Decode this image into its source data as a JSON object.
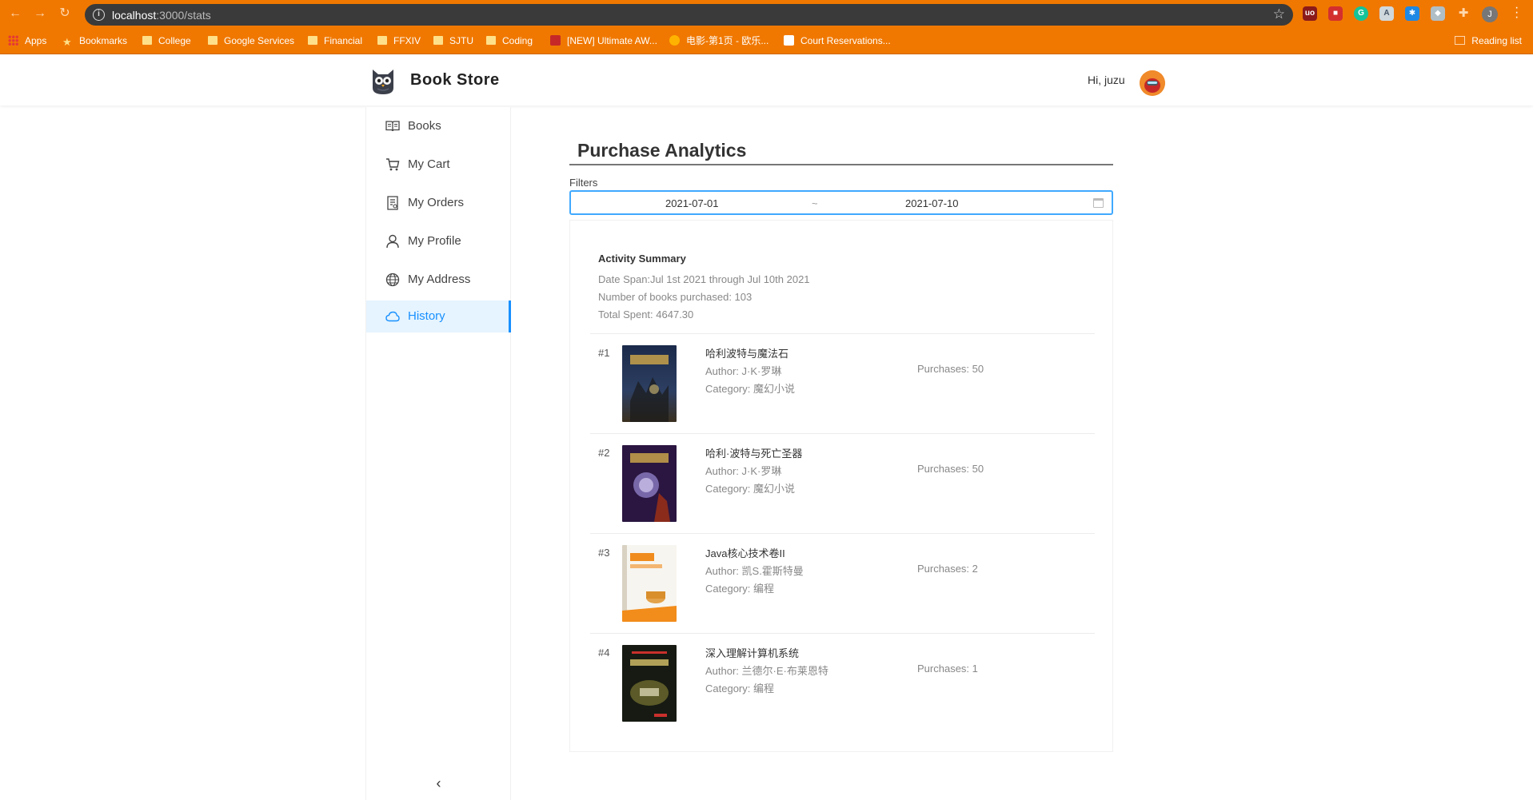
{
  "browser": {
    "url_host": "localhost",
    "url_path": ":3000/stats",
    "bookmarks": [
      {
        "label": "Apps"
      },
      {
        "label": "Bookmarks"
      },
      {
        "label": "College"
      },
      {
        "label": "Google Services"
      },
      {
        "label": "Financial"
      },
      {
        "label": "FFXIV"
      },
      {
        "label": "SJTU"
      },
      {
        "label": "Coding"
      },
      {
        "label": "[NEW] Ultimate AW..."
      },
      {
        "label": "电影-第1页 - 欧乐..."
      },
      {
        "label": "Court Reservations..."
      }
    ],
    "reading_list": "Reading list",
    "profile_initial": "J",
    "accent_color": "#f07800"
  },
  "header": {
    "brand": "Book Store",
    "greeting": "Hi,  juzu"
  },
  "sidebar": {
    "items": [
      {
        "label": "Books",
        "icon": "book-open-icon"
      },
      {
        "label": "My Cart",
        "icon": "cart-icon"
      },
      {
        "label": "My Orders",
        "icon": "orders-icon"
      },
      {
        "label": "My Profile",
        "icon": "user-icon"
      },
      {
        "label": "My Address",
        "icon": "globe-icon"
      },
      {
        "label": "History",
        "icon": "cloud-icon",
        "active": true
      }
    ],
    "collapse_glyph": "‹",
    "active_color": "#1890ff"
  },
  "main": {
    "title": "Purchase Analytics",
    "filters_label": "Filters",
    "range": {
      "start": "2021-07-01",
      "separator": "~",
      "end": "2021-07-10"
    }
  },
  "summary": {
    "title": "Activity Summary",
    "date_span": "Date Span:Jul 1st 2021 through Jul 10th 2021",
    "books_purchased": "Number of books purchased: 103",
    "total_spent": "Total Spent: 4647.30"
  },
  "books": [
    {
      "rank": "#1",
      "title": "哈利波特与魔法石",
      "author": "Author: J·K·罗琳",
      "category": "Category: 魔幻小说",
      "purchases": "Purchases: 50"
    },
    {
      "rank": "#2",
      "title": "哈利·波特与死亡圣器",
      "author": "Author: J·K·罗琳",
      "category": "Category: 魔幻小说",
      "purchases": "Purchases: 50"
    },
    {
      "rank": "#3",
      "title": "Java核心技术卷II",
      "author": "Author: 凯S.霍斯特曼",
      "category": "Category: 编程",
      "purchases": "Purchases: 2"
    },
    {
      "rank": "#4",
      "title": "深入理解计算机系统",
      "author": "Author: 兰德尔·E·布莱恩特",
      "category": "Category: 编程",
      "purchases": "Purchases: 1"
    }
  ]
}
